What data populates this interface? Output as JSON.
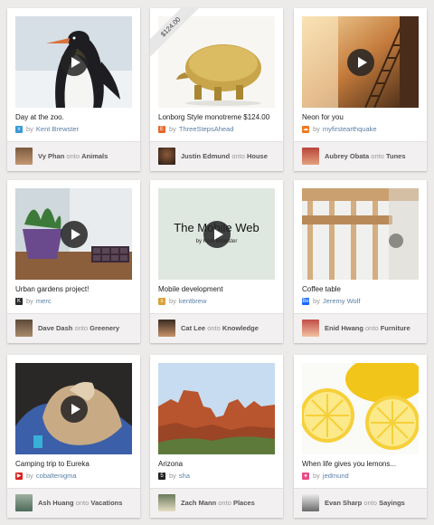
{
  "by_label": "by",
  "onto_label": "onto",
  "cards": [
    {
      "title": "Day at the zoo.",
      "source": "Kent Brewster",
      "source_icon": "vimeo-icon",
      "source_color": "#3a9ad9",
      "pinner": "Vy Phan",
      "board": "Animals",
      "has_video": true
    },
    {
      "title": "Lonborg Style monotreme $124.00",
      "source": "ThreeStepsAhead",
      "source_icon": "etsy-icon",
      "source_color": "#e5672b",
      "pinner": "Justin Edmund",
      "board": "House",
      "has_video": false,
      "price": "$124.00"
    },
    {
      "title": "Neon for you",
      "source": "myfirstearthquake",
      "source_icon": "soundcloud-icon",
      "source_color": "#f07a1f",
      "pinner": "Aubrey Obata",
      "board": "Tunes",
      "has_video": true
    },
    {
      "title": "Urban gardens project!",
      "source": "merc",
      "source_icon": "kickstarter-icon",
      "source_color": "#2b2b2b",
      "pinner": "Dave Dash",
      "board": "Greenery",
      "has_video": true
    },
    {
      "title": "Mobile development",
      "source": "kentbrew",
      "source_icon": "slideshare-icon",
      "source_color": "#d9a33b",
      "pinner": "Cat Lee",
      "board": "Knowledge",
      "has_video": true,
      "slide_title": "The Mobile Web",
      "slide_author": "by Kent Brewster"
    },
    {
      "title": "Coffee table",
      "source": "Jeremy Wolf",
      "source_icon": "behance-icon",
      "source_color": "#1769ff",
      "pinner": "Enid Hwang",
      "board": "Furniture",
      "has_video": false
    },
    {
      "title": "Camping trip to Eureka",
      "source": "cobaltenigma",
      "source_icon": "youtube-icon",
      "source_color": "#d8231e",
      "pinner": "Ash Huang",
      "board": "Vacations",
      "has_video": true
    },
    {
      "title": "Arizona",
      "source": "sha",
      "source_icon": "500px-icon",
      "source_color": "#222222",
      "pinner": "Zach Mann",
      "board": "Places",
      "has_video": false
    },
    {
      "title": "When life gives you lemons...",
      "source": "jedmund",
      "source_icon": "dribbble-icon",
      "source_color": "#ea4c89",
      "pinner": "Evan Sharp",
      "board": "Sayings",
      "has_video": false
    }
  ]
}
